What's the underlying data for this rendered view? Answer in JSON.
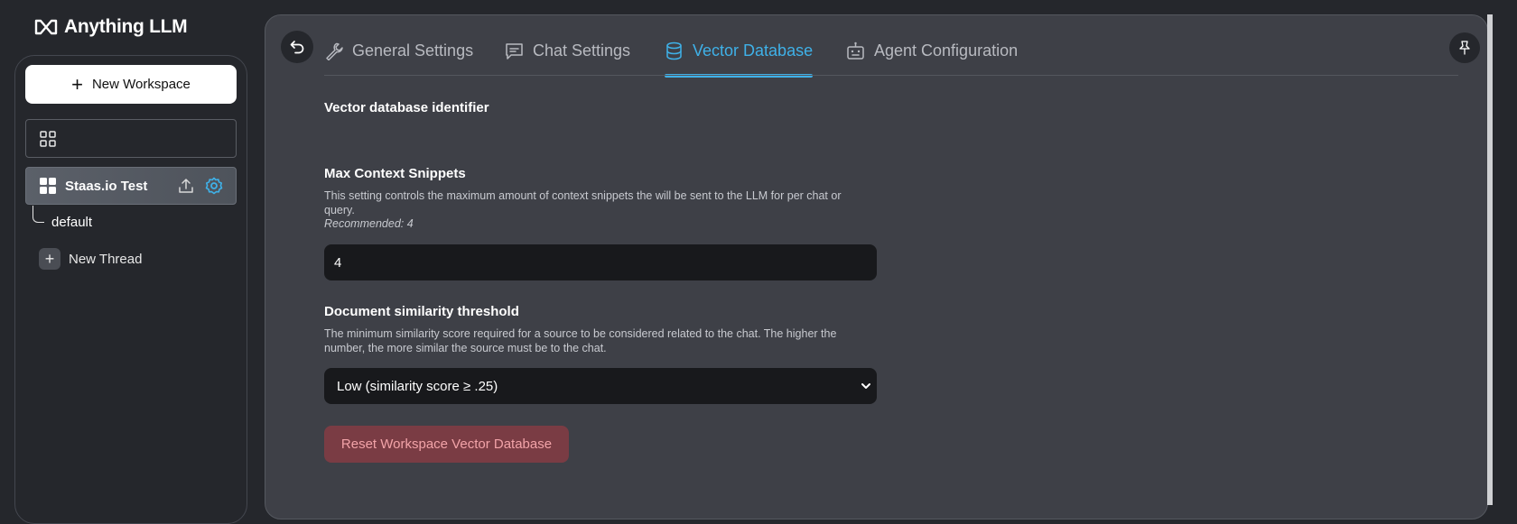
{
  "app": {
    "name": "Anything LLM"
  },
  "sidebar": {
    "new_workspace_label": "New Workspace",
    "search_placeholder": "",
    "workspace": {
      "name": "Staas.io Test"
    },
    "threads": [
      {
        "label": "default"
      }
    ],
    "new_thread_label": "New Thread"
  },
  "tabs": [
    {
      "label": "General Settings",
      "icon": "wrench-icon",
      "active": false
    },
    {
      "label": "Chat Settings",
      "icon": "chat-icon",
      "active": false
    },
    {
      "label": "Vector Database",
      "icon": "database-icon",
      "active": true
    },
    {
      "label": "Agent Configuration",
      "icon": "robot-icon",
      "active": false
    }
  ],
  "settings": {
    "vector_db": {
      "title": "Vector database identifier",
      "value": ""
    },
    "max_context": {
      "title": "Max Context Snippets",
      "description": "This setting controls the maximum amount of context snippets the will be sent to the LLM for per chat or query.",
      "recommended": "Recommended: 4",
      "value": "4"
    },
    "similarity": {
      "title": "Document similarity threshold",
      "description": "The minimum similarity score required for a source to be considered related to the chat. The higher the number, the more similar the source must be to the chat.",
      "selected": "Low (similarity score ≥ .25)"
    },
    "reset_label": "Reset Workspace Vector Database"
  },
  "colors": {
    "accent": "#3fb1e8",
    "danger_bg": "#7a3c44",
    "danger_text": "#f2a3a8"
  }
}
